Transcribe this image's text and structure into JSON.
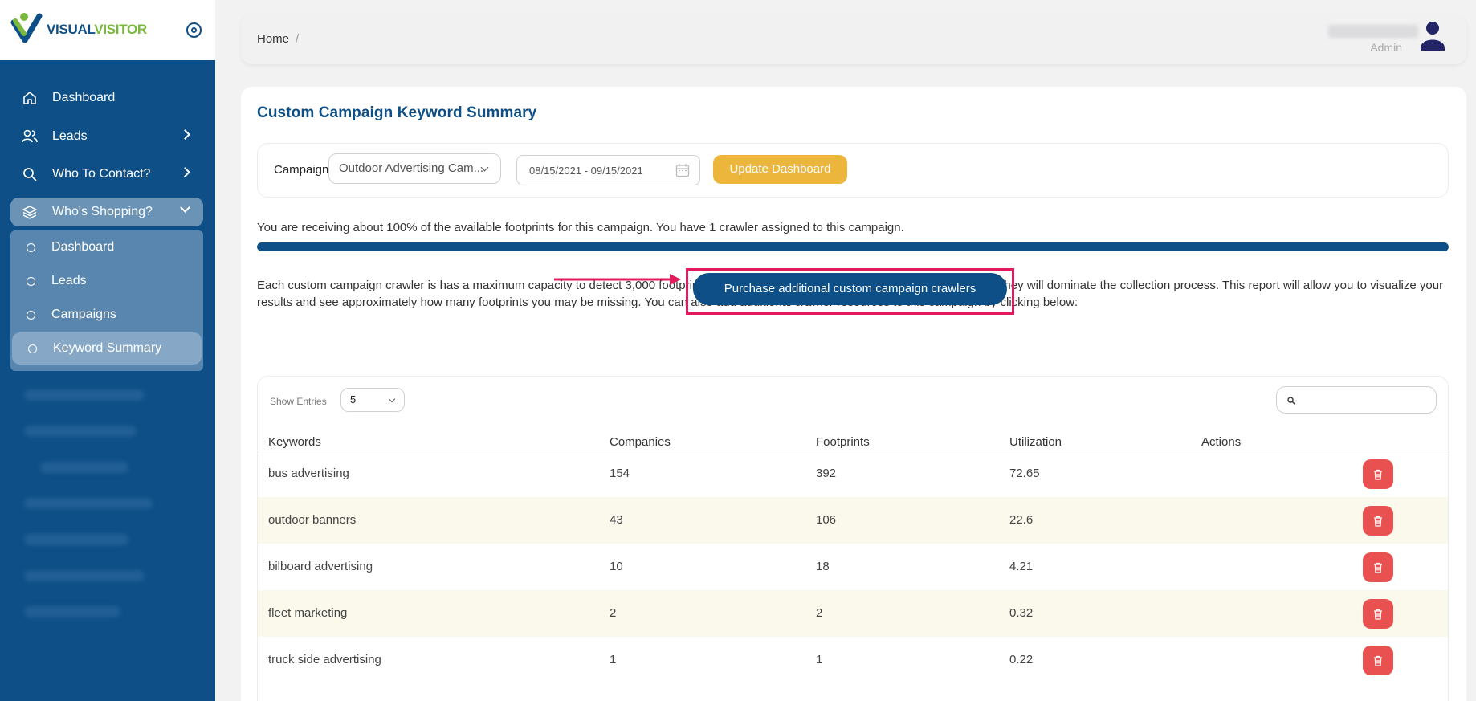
{
  "brand": {
    "part1": "VISUAL",
    "part2": "VISITOR"
  },
  "sidebar": {
    "items": [
      {
        "label": "Dashboard",
        "icon": "home-icon"
      },
      {
        "label": "Leads",
        "icon": "users-icon"
      },
      {
        "label": "Who To Contact?",
        "icon": "search-icon"
      },
      {
        "label": "Who's Shopping?",
        "icon": "layers-icon"
      }
    ],
    "submenu": [
      {
        "label": "Dashboard"
      },
      {
        "label": "Leads"
      },
      {
        "label": "Campaigns"
      },
      {
        "label": "Keyword Summary"
      }
    ]
  },
  "header": {
    "breadcrumb_home": "Home",
    "breadcrumb_sep": "/",
    "user_role": "Admin"
  },
  "page": {
    "title": "Custom Campaign Keyword Summary",
    "campaign_label": "Campaign",
    "campaign_value": "Outdoor Advertising Cam...",
    "date_range": "08/15/2021 - 09/15/2021",
    "update_button": "Update Dashboard",
    "notice": "You are receiving about 100% of the available footprints for this campaign. You have 1 crawler assigned to this campaign.",
    "progress_percent": 100,
    "description": "Each custom campaign crawler is has a maximum capacity to detect 3,000 footprints per month. Sometimes when keywords are too broad, they will dominate the collection process. This report will allow you to visualize your results and see approximately how many footprints you may be missing. You can also add additional crawler resources to this campaign by clicking below:",
    "purchase_button": "Purchase additional custom campaign crawlers"
  },
  "table": {
    "show_entries_label": "Show Entries",
    "show_entries_value": "5",
    "columns": [
      "Keywords",
      "Companies",
      "Footprints",
      "Utilization",
      "Actions"
    ],
    "rows": [
      {
        "keyword": "bus advertising",
        "companies": "154",
        "footprints": "392",
        "utilization": "72.65"
      },
      {
        "keyword": "outdoor banners",
        "companies": "43",
        "footprints": "106",
        "utilization": "22.6"
      },
      {
        "keyword": "bilboard advertising",
        "companies": "10",
        "footprints": "18",
        "utilization": "4.21"
      },
      {
        "keyword": "fleet marketing",
        "companies": "2",
        "footprints": "2",
        "utilization": "0.32"
      },
      {
        "keyword": "truck side advertising",
        "companies": "1",
        "footprints": "1",
        "utilization": "0.22"
      }
    ]
  },
  "colors": {
    "primary": "#0d4f86",
    "accent_yellow": "#ecb53b",
    "highlight_red": "#e31b5d",
    "delete_red": "#e8514f",
    "logo_green": "#7ab83e"
  }
}
